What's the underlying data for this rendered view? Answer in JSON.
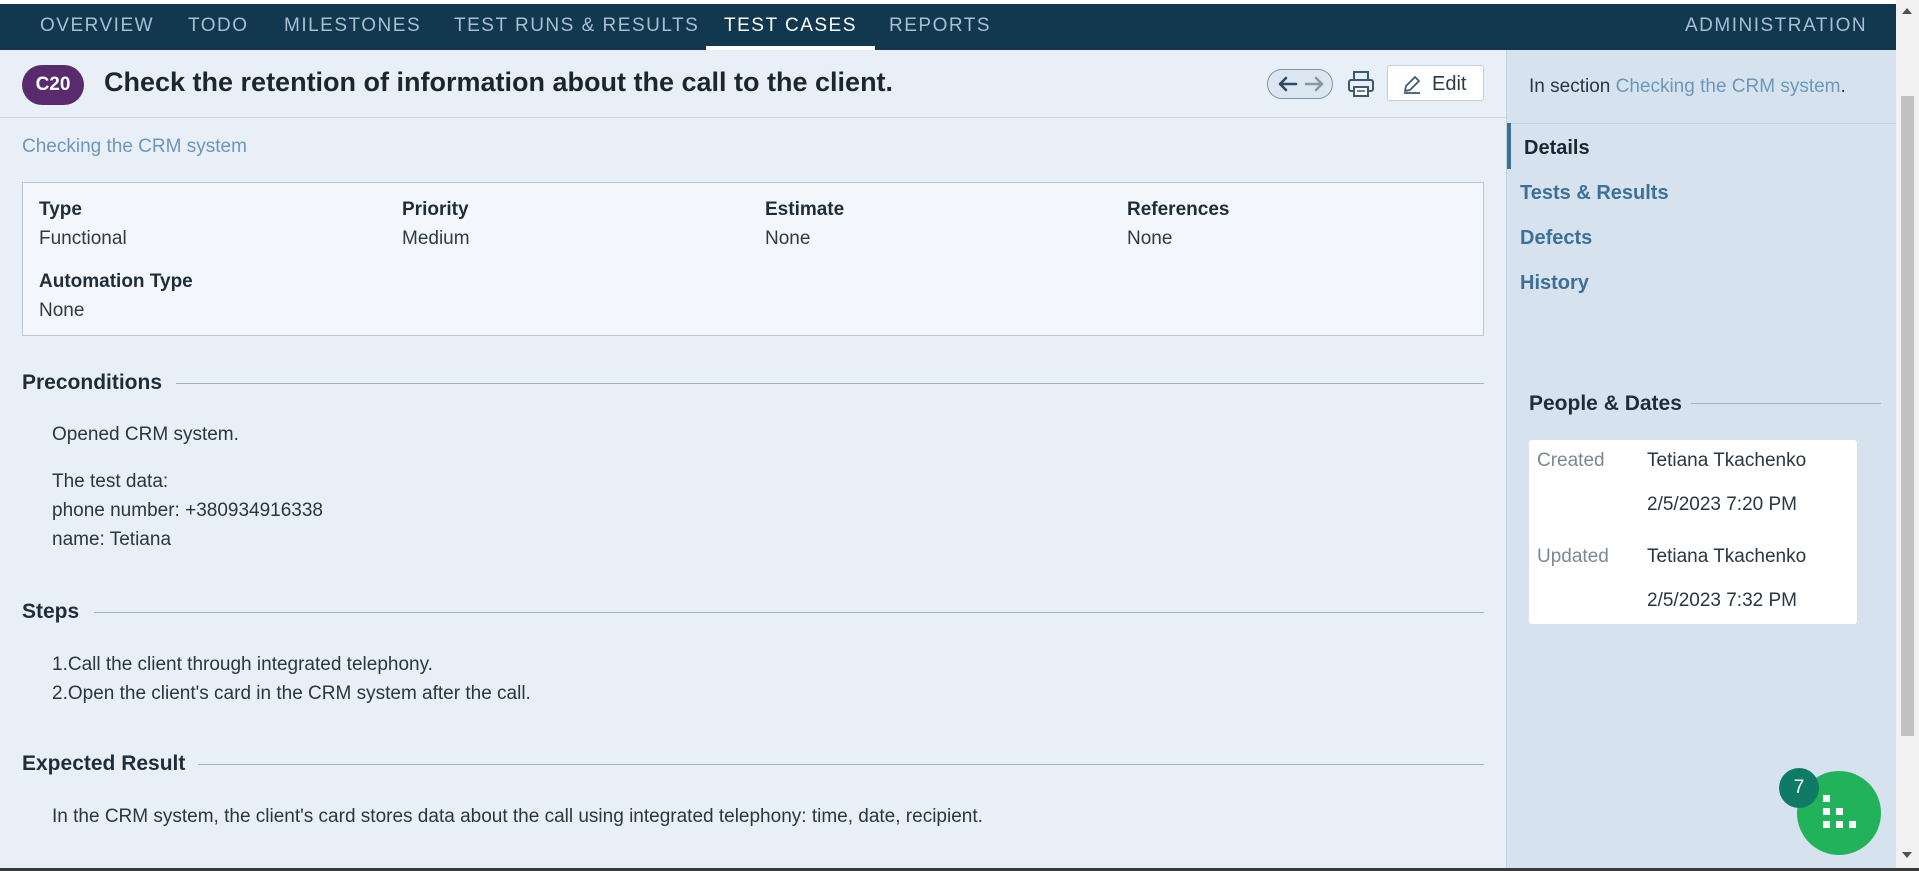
{
  "nav": {
    "items": [
      "OVERVIEW",
      "TODO",
      "MILESTONES",
      "TEST RUNS & RESULTS",
      "TEST CASES",
      "REPORTS"
    ],
    "active": "TEST CASES",
    "admin": "ADMINISTRATION"
  },
  "case": {
    "id": "C20",
    "title": "Check the retention of information about the call to the client.",
    "edit_label": "Edit",
    "section_name": "Checking the CRM system"
  },
  "fields": {
    "type_label": "Type",
    "type_value": "Functional",
    "priority_label": "Priority",
    "priority_value": "Medium",
    "estimate_label": "Estimate",
    "estimate_value": "None",
    "references_label": "References",
    "references_value": "None",
    "automation_label": "Automation Type",
    "automation_value": "None"
  },
  "preconditions": {
    "heading": "Preconditions",
    "line1": "Opened CRM system.",
    "line2": "The test data:",
    "line3": "phone number: +380934916338",
    "line4": "name: Tetiana"
  },
  "steps": {
    "heading": "Steps",
    "step1": "1.Call the client through integrated telephony.",
    "step2": "2.Open the client's card in the CRM system after the call."
  },
  "expected": {
    "heading": "Expected Result",
    "text": "In the CRM system, the client's card stores data about the call using integrated telephony: time, date, recipient."
  },
  "sidebar": {
    "in_section_prefix": "In section",
    "in_section_link": "Checking the CRM system",
    "in_section_suffix": ".",
    "nav": [
      "Details",
      "Tests & Results",
      "Defects",
      "History"
    ],
    "active_nav": "Details",
    "people_dates_title": "People & Dates",
    "created_label": "Created",
    "created_by": "Tetiana Tkachenko",
    "created_date": "2/5/2023 7:20 PM",
    "updated_label": "Updated",
    "updated_by": "Tetiana Tkachenko",
    "updated_date": "2/5/2023 7:32 PM"
  },
  "widget": {
    "badge_count": "7"
  },
  "colors": {
    "navbar": "#12384f",
    "badge": "#5a2a6e",
    "link": "#6d97ba",
    "fab": "#22b35a"
  }
}
